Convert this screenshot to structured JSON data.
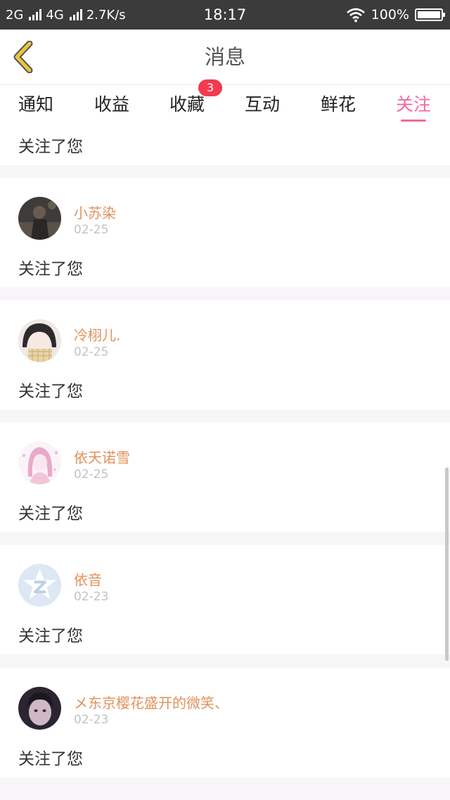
{
  "status_bar": {
    "net1": "2G",
    "net2": "4G",
    "speed": "2.7K/s",
    "time": "18:17",
    "battery": "100%"
  },
  "header": {
    "title": "消息"
  },
  "tabs": [
    {
      "label": "通知"
    },
    {
      "label": "收益"
    },
    {
      "label": "收藏",
      "badge": "3"
    },
    {
      "label": "互动"
    },
    {
      "label": "鲜花"
    },
    {
      "label": "关注",
      "active": true
    }
  ],
  "partial_item": {
    "message": "关注了您"
  },
  "items": [
    {
      "name": "小苏染",
      "date": "02-25",
      "message": "关注了您"
    },
    {
      "name": "冷栩儿.",
      "date": "02-25",
      "message": "关注了您"
    },
    {
      "name": "依天诺雪",
      "date": "02-25",
      "message": "关注了您"
    },
    {
      "name": "依音",
      "date": "02-23",
      "message": "关注了您"
    },
    {
      "name": "メ东京樱花盛开的微笑、",
      "date": "02-23",
      "message": "关注了您"
    }
  ],
  "colors": {
    "accent_pink": "#f06aa0",
    "name_orange": "#e0925c",
    "badge_red": "#f33a4e",
    "back_yellow": "#e8c63a"
  }
}
